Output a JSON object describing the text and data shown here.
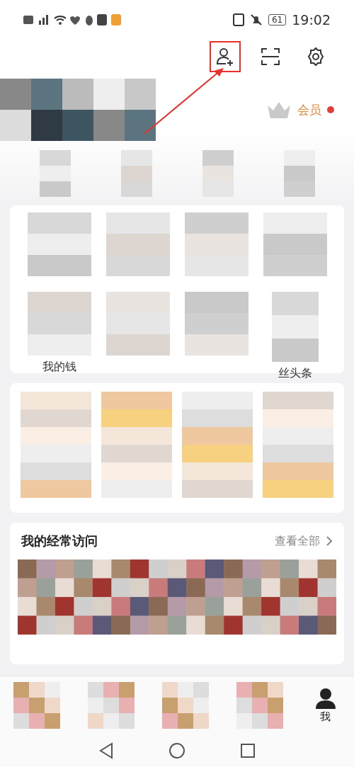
{
  "status_bar": {
    "time": "19:02",
    "battery": "61"
  },
  "header": {
    "actions": [
      {
        "kind": "add_friend",
        "highlighted": true
      },
      {
        "kind": "scan",
        "highlighted": false
      },
      {
        "kind": "settings",
        "highlighted": false
      }
    ],
    "member_label": "会员",
    "member_unread": true
  },
  "shortcut_grid": {
    "labels": [
      "我的钱",
      "丝头条"
    ]
  },
  "frequent_visits": {
    "title": "我的经常访问",
    "view_all": "查看全部"
  },
  "bottom_nav": [
    {
      "label": "我",
      "selected": true
    }
  ]
}
